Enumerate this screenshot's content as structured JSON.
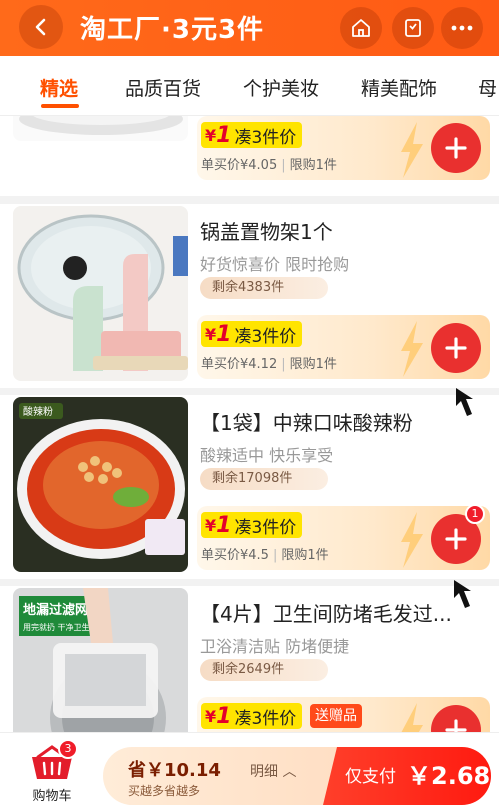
{
  "header": {
    "title": "淘工厂·3元3件",
    "back_icon": "back-arrow-icon",
    "home_icon": "home-icon",
    "bookmark_icon": "bookmark-icon",
    "more_icon": "more-icon"
  },
  "tabs": [
    {
      "label": "精选",
      "active": true
    },
    {
      "label": "品质百货",
      "active": false
    },
    {
      "label": "个护美妆",
      "active": false
    },
    {
      "label": "精美配饰",
      "active": false
    },
    {
      "label": "母",
      "active": false
    }
  ],
  "products": [
    {
      "deal_yen": "¥",
      "deal_one": "1",
      "deal_text": "凑3件价",
      "single_price": "单买价¥4.05",
      "limit": "限购1件"
    },
    {
      "title": "锅盖置物架1个",
      "subtitle": "好货惊喜价 限时抢购",
      "stock": "剩余4383件",
      "deal_yen": "¥",
      "deal_one": "1",
      "deal_text": "凑3件价",
      "single_price": "单买价¥4.12",
      "limit": "限购1件"
    },
    {
      "title": "【1袋】中辣口味酸辣粉",
      "subtitle": "酸辣适中 快乐享受",
      "stock": "剩余17098件",
      "deal_yen": "¥",
      "deal_one": "1",
      "deal_text": "凑3件价",
      "single_price": "单买价¥4.5",
      "limit": "限购1件",
      "badge": "1",
      "image_text": "酸辣粉"
    },
    {
      "title": "【4片】卫生间防堵毛发过...",
      "subtitle": "卫浴清洁贴 防堵便捷",
      "stock": "剩余2649件",
      "deal_yen": "¥",
      "deal_one": "1",
      "deal_text": "凑3件价",
      "gift": "送赠品",
      "image_title": "地漏过滤网",
      "image_caption": "用完就扔 干净卫生"
    }
  ],
  "bottom": {
    "cart_label": "购物车",
    "cart_badge": "3",
    "save_amount": "省￥10.14",
    "save_sub": "买越多省越多",
    "detail": "明细 ︿",
    "pay_text": "仅支付",
    "pay_amount": "￥2.68"
  },
  "colors": {
    "header": "#ff6a1a",
    "accent": "#ff5000",
    "add_button": "#e9302f",
    "deal_tag": "#ffe400"
  }
}
